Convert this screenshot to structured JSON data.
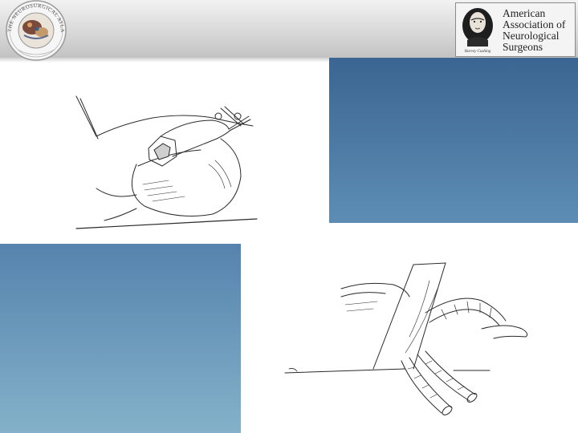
{
  "header": {
    "seal_text": "THE NEUROSURGICAL ATLAS",
    "logo": {
      "lines": [
        "American",
        "Association of",
        "Neurological",
        "Surgeons"
      ],
      "signature": "Harvey Cushing"
    }
  },
  "colors": {
    "header_top": "#f2f2f2",
    "header_bottom": "#c2c2c2",
    "blue_panel_dark": "#3b6592",
    "blue_panel_light": "#84b1c9"
  },
  "illustrations": [
    {
      "name": "sac-clamp-illustration"
    },
    {
      "name": "vessel-dissection-illustration"
    }
  ]
}
